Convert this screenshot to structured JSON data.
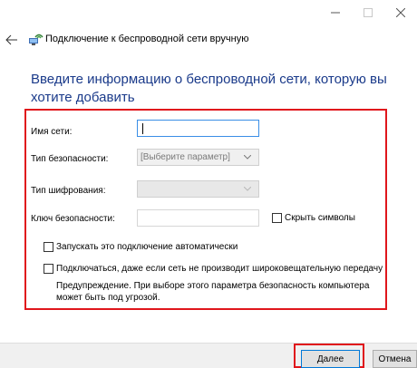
{
  "window": {
    "title": "Подключение к беспроводной сети вручную"
  },
  "heading": "Введите информацию о беспроводной сети, которую вы хотите добавить",
  "form": {
    "network_name_label": "Имя сети:",
    "network_name_value": "",
    "security_type_label": "Тип безопасности:",
    "security_type_selected": "[Выберите параметр]",
    "encryption_type_label": "Тип шифрования:",
    "encryption_type_selected": "",
    "security_key_label": "Ключ безопасности:",
    "security_key_value": "",
    "hide_chars_label": "Скрыть символы",
    "auto_connect_label": "Запускать это подключение автоматически",
    "connect_hidden_label": "Подключаться, даже если сеть не производит широковещательную передачу",
    "warning": "Предупреждение. При выборе этого параметра безопасность компьютера может быть под угрозой."
  },
  "footer": {
    "next_label": "Далее",
    "cancel_label": "Отмена"
  },
  "colors": {
    "heading": "#1a3a8a",
    "highlight": "#e0161c",
    "focus": "#3a8ee6"
  }
}
